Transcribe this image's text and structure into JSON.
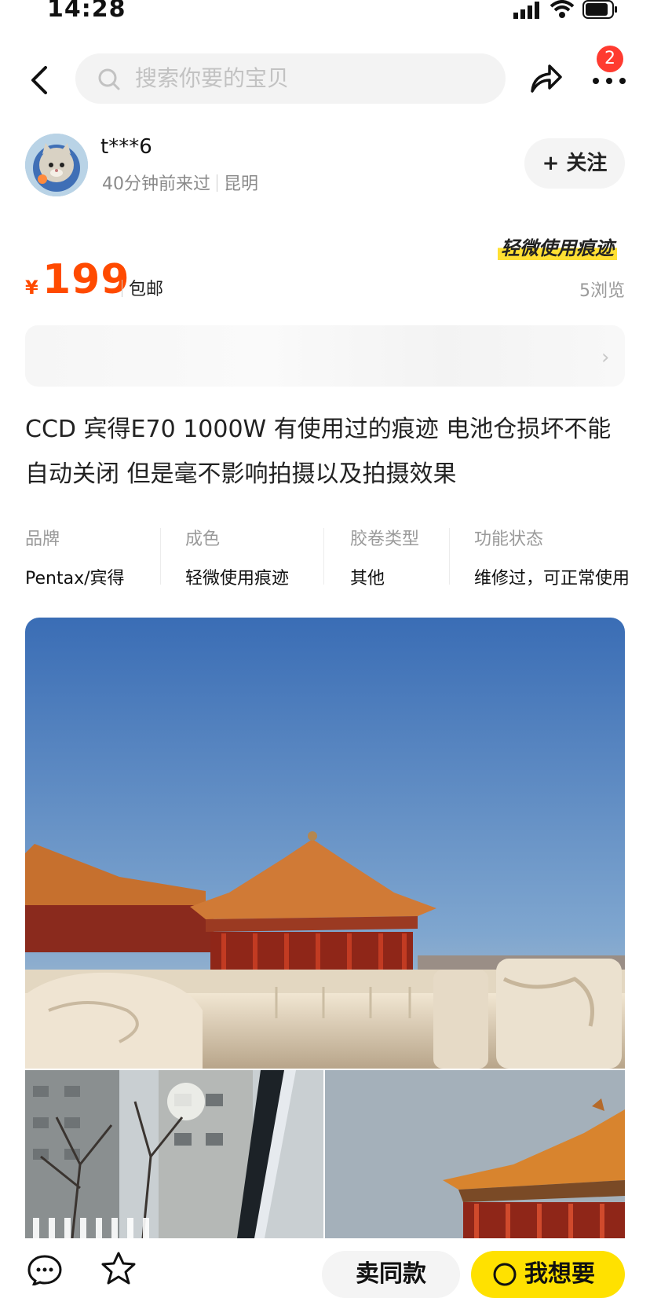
{
  "status_bar": {
    "time": "14:28"
  },
  "nav": {
    "search_placeholder": "搜索你要的宝贝",
    "badge_count": "2"
  },
  "seller": {
    "name": "t***6",
    "last_seen": "40分钟前来过",
    "city": "昆明",
    "follow_label": "+ 关注"
  },
  "price_block": {
    "condition_tag": "轻微使用痕迹",
    "currency": "¥",
    "price": "199",
    "shipping": "包邮",
    "views": "5浏览"
  },
  "description": "CCD 宾得E70 1000W 有使用过的痕迹 电池仓损坏不能自动关闭 但是毫不影响拍摄以及拍摄效果",
  "specs": [
    {
      "label": "品牌",
      "value": "Pentax/宾得"
    },
    {
      "label": "成色",
      "value": "轻微使用痕迹"
    },
    {
      "label": "胶卷类型",
      "value": "其他"
    },
    {
      "label": "功能状态",
      "value": "维修过，可正常使用"
    }
  ],
  "bottom": {
    "ask_label": "卖同款",
    "want_label": "我想要"
  },
  "colors": {
    "accent_price": "#ff4a00",
    "want_button": "#ffe100",
    "badge": "#ff3b30"
  }
}
